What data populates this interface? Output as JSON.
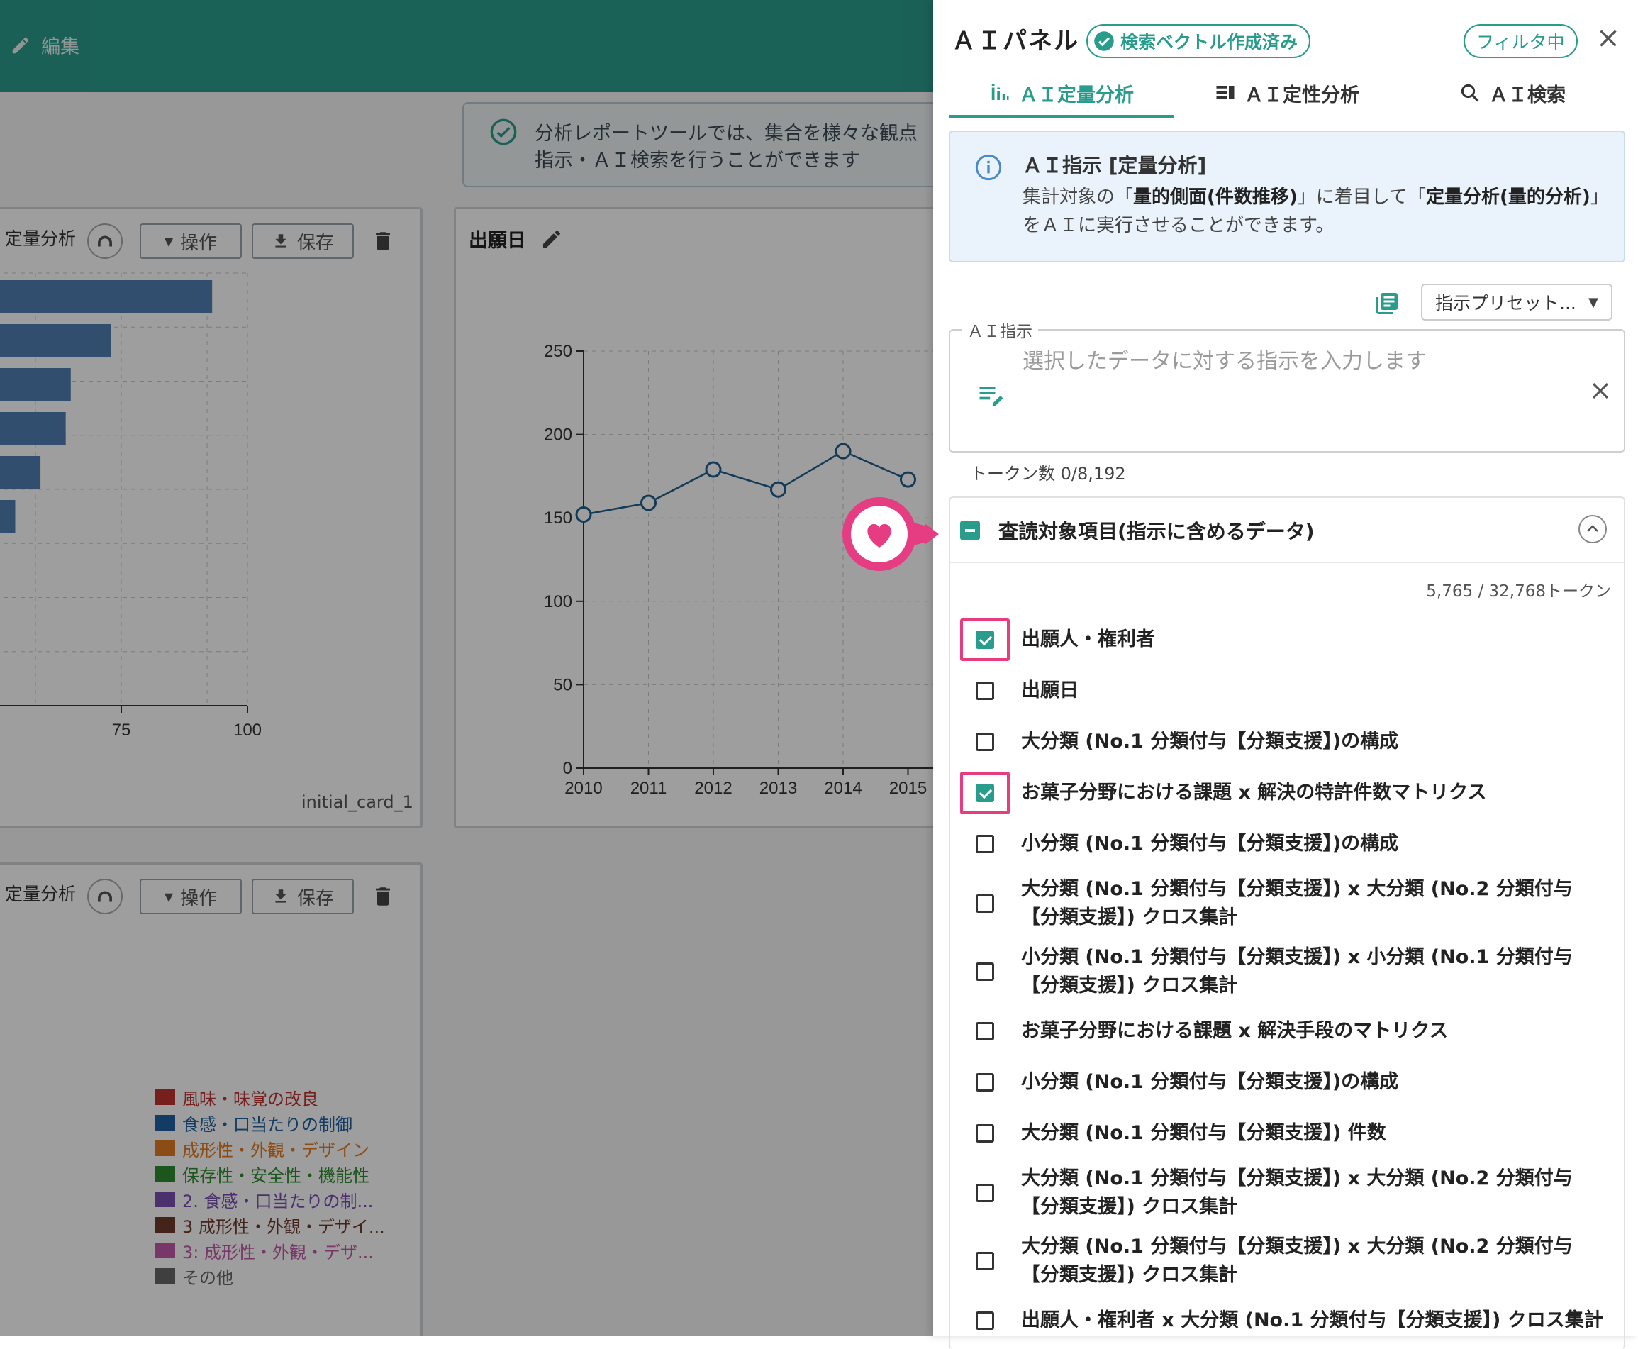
{
  "app": {
    "edit_label": "編集",
    "banner_line1": "分析レポートツールでは、集合を様々な観点",
    "banner_line2": "指示・ＡＩ検索を行うことができます"
  },
  "cards": {
    "card1": {
      "title": "定量分析",
      "ops_label": "操作",
      "save_label": "保存",
      "x_ticks": [
        "75",
        "100"
      ],
      "footer_id": "initial_card_1"
    },
    "card2": {
      "title": "出願日"
    },
    "card3": {
      "title": "定量分析",
      "ops_label": "操作",
      "save_label": "保存",
      "legend": [
        {
          "label": "風味・味覚の改良",
          "color": "#c0322f"
        },
        {
          "label": "食感・口当たりの制御",
          "color": "#1f5fa0"
        },
        {
          "label": "成形性・外観・デザイン",
          "color": "#e07b22"
        },
        {
          "label": "保存性・安全性・機能性",
          "color": "#2e8b2e"
        },
        {
          "label": "2. 食感・口当たりの制...",
          "color": "#7b4db0"
        },
        {
          "label": "3 成形性・外観・デザイ...",
          "color": "#6e3b2a"
        },
        {
          "label": "3: 成形性・外観・デザ...",
          "color": "#c25aa8"
        },
        {
          "label": "その他",
          "color": "#666666"
        }
      ]
    }
  },
  "chart_data": [
    {
      "type": "bar",
      "orientation": "horizontal",
      "title": "定量分析",
      "values": [
        93,
        73,
        65,
        64,
        59,
        54
      ],
      "xlim_visible": [
        50,
        100
      ],
      "x_ticks": [
        75,
        100
      ],
      "grid": true
    },
    {
      "type": "line",
      "title": "出願日",
      "x": [
        2010,
        2011,
        2012,
        2013,
        2014,
        2015
      ],
      "values": [
        152,
        159,
        179,
        167,
        190,
        173
      ],
      "ylim": [
        0,
        250
      ],
      "y_ticks": [
        0,
        50,
        100,
        150,
        200,
        250
      ],
      "grid": true,
      "color": "#1f5f8b"
    }
  ],
  "panel": {
    "title": "ＡＩパネル",
    "vector_badge": "検索ベクトル作成済み",
    "filter_badge": "フィルタ中",
    "tabs": [
      {
        "label": "ＡＩ定量分析",
        "icon": "bar-chart-icon",
        "active": true
      },
      {
        "label": "ＡＩ定性分析",
        "icon": "list-icon",
        "active": false
      },
      {
        "label": "ＡＩ検索",
        "icon": "search-icon",
        "active": false
      }
    ],
    "info": {
      "title": "ＡＩ指示 [定量分析]",
      "desc_pre": "集計対象の「",
      "desc_b1": "量的側面(件数推移)",
      "desc_mid": "」に着目して「",
      "desc_b2": "定量分析(量的分析)",
      "desc_post": "」をＡＩに実行させることができます。"
    },
    "preset_label": "指示プリセット...",
    "ai_field_label": "ＡＩ指示",
    "ai_field_placeholder": "選択したデータに対する指示を入力します",
    "token_count": "トークン数 0/8,192",
    "review": {
      "title": "査読対象項目(指示に含めるデータ)",
      "tokens": "5,765 / 32,768トークン",
      "items": [
        {
          "label": "出願人・権利者",
          "checked": true
        },
        {
          "label": "出願日",
          "checked": false
        },
        {
          "label": "大分類 (No.1 分類付与【分類支援】)の構成",
          "checked": false
        },
        {
          "label": "お菓子分野における課題 x 解決の特許件数マトリクス",
          "checked": true
        },
        {
          "label": "小分類 (No.1 分類付与【分類支援】)の構成",
          "checked": false
        },
        {
          "label": "大分類 (No.1 分類付与【分類支援】) x 大分類 (No.2 分類付与【分類支援】) クロス集計",
          "checked": false
        },
        {
          "label": "小分類 (No.1 分類付与【分類支援】) x 小分類 (No.1 分類付与【分類支援】) クロス集計",
          "checked": false
        },
        {
          "label": "お菓子分野における課題 x 解決手段のマトリクス",
          "checked": false
        },
        {
          "label": "小分類 (No.1 分類付与【分類支援】)の構成",
          "checked": false
        },
        {
          "label": "大分類 (No.1 分類付与【分類支援】) 件数",
          "checked": false
        },
        {
          "label": "大分類 (No.1 分類付与【分類支援】) x 大分類 (No.2 分類付与【分類支援】) クロス集計",
          "checked": false
        },
        {
          "label": "大分類 (No.1 分類付与【分類支援】) x 大分類 (No.2 分類付与【分類支援】) クロス集計",
          "checked": false
        },
        {
          "label": "出願人・権利者 x 大分類 (No.1 分類付与【分類支援】) クロス集計",
          "checked": false
        }
      ]
    }
  }
}
